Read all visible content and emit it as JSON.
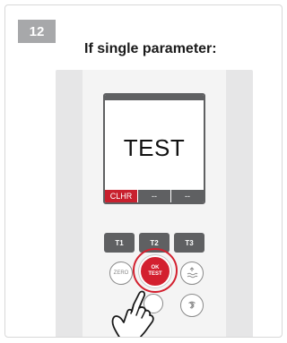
{
  "step": {
    "number": "12"
  },
  "heading": "If single parameter:",
  "device": {
    "screen_text": "TEST",
    "softkeys": [
      "CLHR",
      "--",
      "--"
    ],
    "tkeys": [
      "T1",
      "T2",
      "T3"
    ],
    "zero_label": "ZERO",
    "ok_label_line1": "OK",
    "ok_label_line2": "TEST"
  },
  "colors": {
    "accent_red": "#d3202f",
    "badge_gray": "#a7a8aa",
    "key_gray": "#5f6062"
  },
  "icons": {
    "tide": "tide-icon",
    "bluetooth": "bluetooth-icon",
    "hand": "pointing-hand-icon"
  }
}
